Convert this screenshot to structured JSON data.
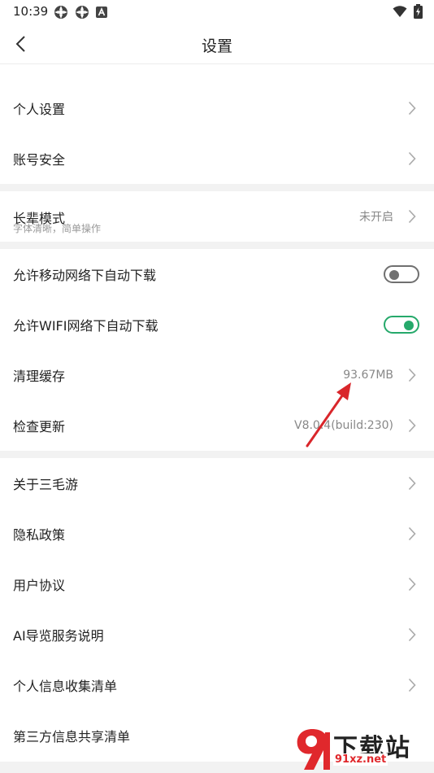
{
  "status": {
    "time": "10:39",
    "icons_left": [
      "app-icon",
      "app-icon",
      "a-icon"
    ],
    "icons_right": [
      "wifi-icon",
      "battery-charging-icon"
    ]
  },
  "titlebar": {
    "title": "设置",
    "back_icon": "chevron-left-icon"
  },
  "group1": {
    "items": [
      {
        "label": "个人设置"
      },
      {
        "label": "账号安全"
      }
    ]
  },
  "elder_mode": {
    "label": "长辈模式",
    "sublabel": "字体清晰，简单操作",
    "value": "未开启"
  },
  "group3": {
    "mobile_download": {
      "label": "允许移动网络下自动下载",
      "enabled": false
    },
    "wifi_download": {
      "label": "允许WIFI网络下自动下载",
      "enabled": true
    },
    "clear_cache": {
      "label": "清理缓存",
      "value": "93.67MB"
    },
    "check_update": {
      "label": "检查更新",
      "value": "V8.0.4(build:230)"
    }
  },
  "group4": {
    "items": [
      {
        "label": "关于三毛游"
      },
      {
        "label": "隐私政策"
      },
      {
        "label": "用户协议"
      },
      {
        "label": "AI导览服务说明"
      },
      {
        "label": "个人信息收集清单"
      },
      {
        "label": "第三方信息共享清单"
      }
    ]
  },
  "watermark": {
    "title": "下载站",
    "site": "91xz.net"
  },
  "colors": {
    "accent_green": "#26a96b",
    "annotation_red": "#d9262b",
    "separator": "#f2f2f2"
  }
}
